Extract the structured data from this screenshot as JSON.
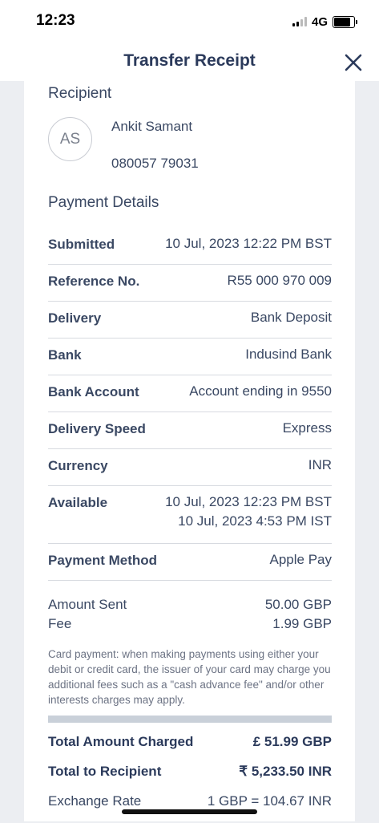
{
  "status_bar": {
    "time": "12:23",
    "network": "4G"
  },
  "header": {
    "title": "Transfer Receipt"
  },
  "recipient": {
    "section_title": "Recipient",
    "initials": "AS",
    "name": "Ankit Samant",
    "account_number": "080057 79031"
  },
  "payment_details": {
    "section_title": "Payment Details",
    "rows": [
      {
        "label": "Submitted",
        "value": "10 Jul, 2023 12:22 PM BST"
      },
      {
        "label": "Reference No.",
        "value": "R55 000 970 009"
      },
      {
        "label": "Delivery",
        "value": "Bank Deposit"
      },
      {
        "label": "Bank",
        "value": "Indusind Bank"
      },
      {
        "label": "Bank Account",
        "value": "Account ending in 9550"
      },
      {
        "label": "Delivery Speed",
        "value": "Express"
      },
      {
        "label": "Currency",
        "value": "INR"
      },
      {
        "label": "Available",
        "value": "10 Jul, 2023 12:23 PM BST",
        "value2": "10 Jul, 2023 4:53 PM IST"
      },
      {
        "label": "Payment Method",
        "value": "Apple Pay"
      }
    ]
  },
  "amounts": {
    "amount_sent_label": "Amount Sent",
    "amount_sent_value": "50.00 GBP",
    "fee_label": "Fee",
    "fee_value": "1.99 GBP"
  },
  "disclaimer": "Card payment: when making payments using either your debit or credit card, the issuer of your card may charge you additional fees such as a \"cash advance fee\" and/or other interests charges may apply.",
  "totals": {
    "total_charged_label": "Total Amount Charged",
    "total_charged_value": "£ 51.99 GBP",
    "total_recipient_label": "Total to Recipient",
    "total_recipient_value": "₹ 5,233.50 INR",
    "exchange_rate_label": "Exchange Rate",
    "exchange_rate_value": "1 GBP = 104.67 INR"
  }
}
